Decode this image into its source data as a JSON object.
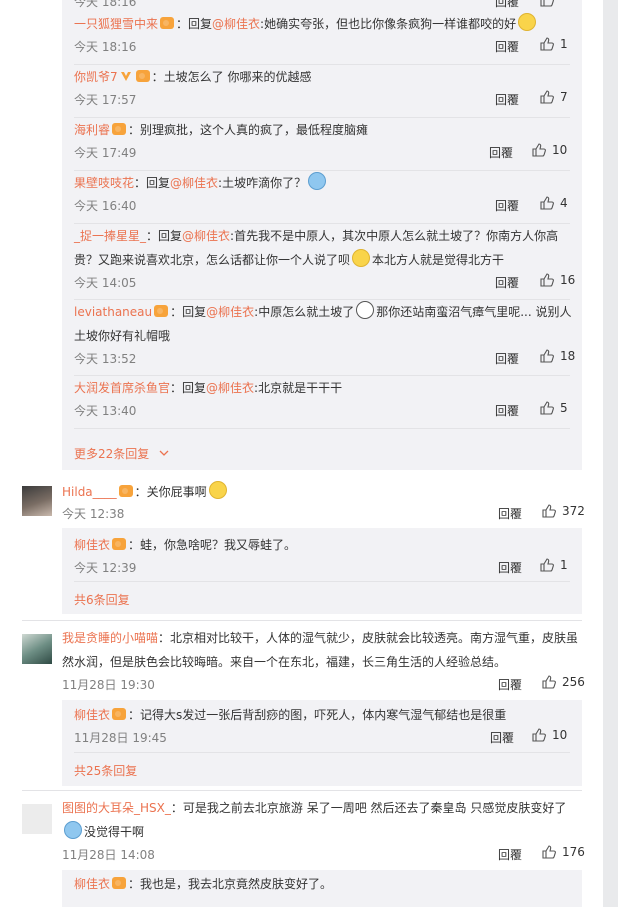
{
  "top_time": "今天 18:16",
  "reply_label": "回覆",
  "replies1": [
    {
      "name": "一只狐狸雪中来",
      "badge": "vip",
      "prefix": "：回复",
      "reply_to": "@柳佳衣",
      "text": ":她确实夸张，但也比你像条疯狗一样谁都咬的好",
      "emoji": "smile",
      "time": "今天 18:16",
      "likes": "1"
    },
    {
      "name": "你凯爷7",
      "badge": "v",
      "prefix": "：",
      "reply_to": "",
      "text": "土坡怎么了 你哪来的优越感",
      "time": "今天 17:57",
      "likes": "7"
    },
    {
      "name": "海利睿",
      "badge": "vip",
      "prefix": "：",
      "reply_to": "",
      "text": "别理疯批，这个人真的疯了，最低程度脑瘫",
      "time": "今天 17:49",
      "likes": "10"
    },
    {
      "name": "果壁吱吱花",
      "badge": "",
      "prefix": "：回复",
      "reply_to": "@柳佳衣",
      "text": ":土坡咋滴你了？",
      "emoji": "blue",
      "time": "今天 16:40",
      "likes": "4"
    },
    {
      "name": "_捉一捧星星_",
      "badge": "",
      "prefix": "：回复",
      "reply_to": "@柳佳衣",
      "text": ":首先我不是中原人，其次中原人怎么就土坡了？你南方人你高",
      "text2": "贵？又跑来说喜欢北京，怎么话都让你一个人说了呗",
      "text3": "本北方人就是觉得北方干",
      "time": "今天 14:05",
      "likes": "16"
    },
    {
      "name": "leviathaneau",
      "badge": "vip",
      "prefix": "：回复",
      "reply_to": "@柳佳衣",
      "text": ":中原怎么就土坡了",
      "text_after": "那你还站南蛮沼气瘴气里呢... 说别人",
      "text2": "土坡你好有礼帽哦",
      "time": "今天 13:52",
      "likes": "18"
    },
    {
      "name": "大润发首席杀鱼官",
      "badge": "",
      "prefix": "：回复",
      "reply_to": "@柳佳衣",
      "text": ":北京就是干干干",
      "time": "今天 13:40",
      "likes": "5"
    }
  ],
  "more1": "更多22条回复",
  "hilda": {
    "name": "Hilda____",
    "text": "：关你屁事啊",
    "time": "今天 12:38",
    "likes": "372"
  },
  "hilda_reply": {
    "name": "柳佳衣",
    "text": "：蛙，你急啥呢？我又辱蛙了。",
    "time": "今天 12:39",
    "likes": "1"
  },
  "more2": "共6条回复",
  "xiaomi": {
    "name": "我是贪睡的小喵喵",
    "text": "：北京相对比较干，人体的湿气就少，皮肤就会比较透亮。南方湿气重，皮肤虽",
    "text2": "然水润，但是肤色会比较晦暗。来自一个在东北，福建，长三角生活的人经验总结。",
    "time": "11月28日 19:30",
    "likes": "256"
  },
  "xiaomi_reply": {
    "name": "柳佳衣",
    "text": "：记得大s发过一张后背刮痧的图，吓死人，体内寒气湿气郁结也是很重",
    "time": "11月28日 19:45",
    "likes": "10"
  },
  "more3": "共25条回复",
  "hsx": {
    "name": "图图的大耳朵_HSX_",
    "text": "：可是我之前去北京旅游 呆了一周吧 然后还去了秦皇岛 只感觉皮肤变好了",
    "text2": "没觉得干啊",
    "time": "11月28日 14:08",
    "likes": "176"
  },
  "hsx_reply": {
    "name": "柳佳衣",
    "text": "：我也是，我去北京竟然皮肤变好了。"
  }
}
